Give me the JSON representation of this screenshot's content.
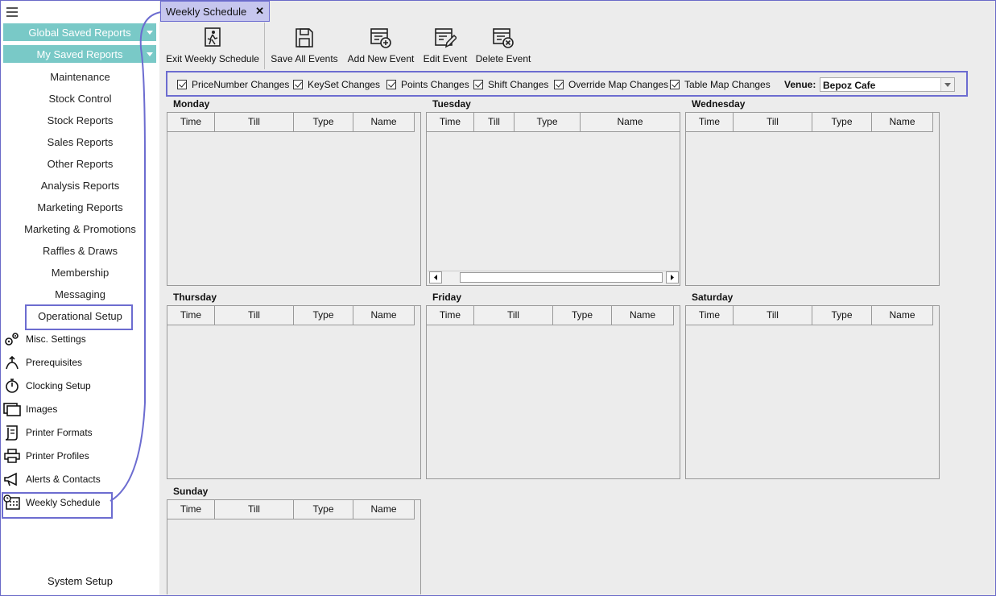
{
  "sidebar": {
    "global_saved_reports": "Global Saved Reports",
    "my_saved_reports": "My Saved Reports",
    "menu": [
      "Maintenance",
      "Stock Control",
      "Stock Reports",
      "Sales Reports",
      "Other Reports",
      "Analysis Reports",
      "Marketing Reports",
      "Marketing & Promotions",
      "Raffles & Draws",
      "Membership",
      "Messaging",
      "Operational Setup"
    ],
    "sub_items": [
      {
        "label": "Misc. Settings",
        "icon": "gears-icon"
      },
      {
        "label": "Prerequisites",
        "icon": "prerequisites-icon"
      },
      {
        "label": "Clocking Setup",
        "icon": "stopwatch-icon"
      },
      {
        "label": "Images",
        "icon": "images-icon"
      },
      {
        "label": "Printer Formats",
        "icon": "printer-format-icon"
      },
      {
        "label": "Printer Profiles",
        "icon": "printer-icon"
      },
      {
        "label": "Alerts & Contacts",
        "icon": "megaphone-icon"
      },
      {
        "label": "Weekly Schedule",
        "icon": "calendar-clock-icon"
      }
    ],
    "system_setup": "System Setup"
  },
  "tab": {
    "label": "Weekly Schedule",
    "close": "✕"
  },
  "toolbar": {
    "exit": "Exit Weekly Schedule",
    "save_all": "Save All Events",
    "add_new": "Add New Event",
    "edit": "Edit Event",
    "delete": "Delete Event"
  },
  "filters": {
    "checkboxes": [
      "PriceNumber Changes",
      "KeySet Changes",
      "Points Changes",
      "Shift Changes",
      "Override Map Changes",
      "Table Map Changes"
    ],
    "venue_label": "Venue:",
    "venue_value": "Bepoz Cafe"
  },
  "columns": [
    "Time",
    "Till",
    "Type",
    "Name"
  ],
  "days": [
    "Monday",
    "Tuesday",
    "Wednesday",
    "Thursday",
    "Friday",
    "Saturday",
    "Sunday"
  ],
  "colors": {
    "accent": "#6c6cd0",
    "teal": "#79c9c7"
  }
}
